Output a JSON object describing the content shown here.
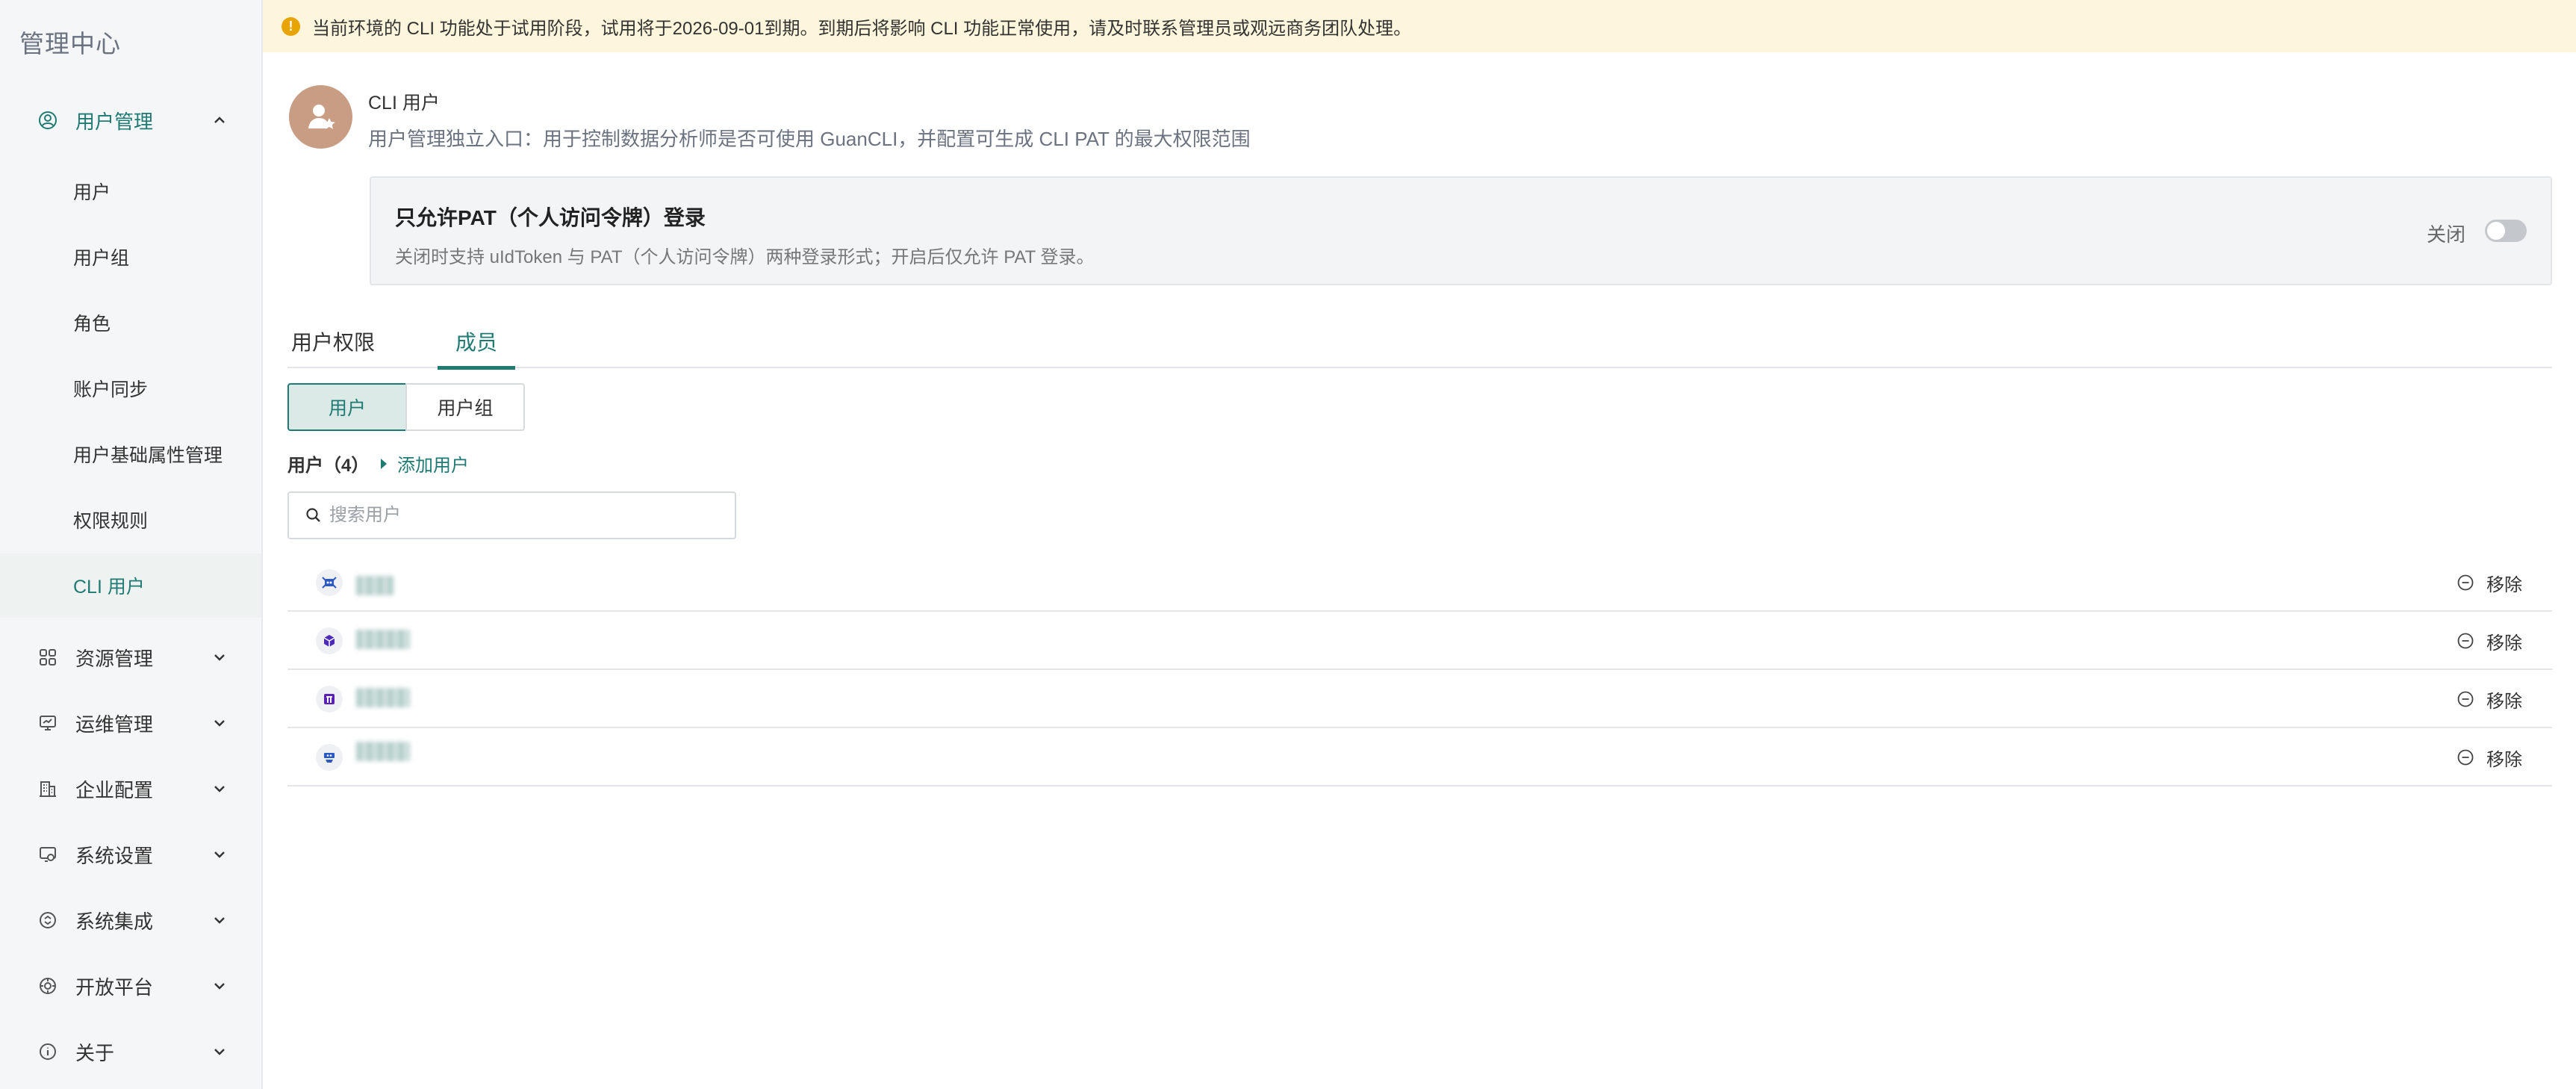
{
  "sidebar": {
    "brand": "管理中心",
    "user_management": {
      "label": "用户管理",
      "icon": "user-circle-icon",
      "items": [
        {
          "label": "用户"
        },
        {
          "label": "用户组"
        },
        {
          "label": "角色"
        },
        {
          "label": "账户同步"
        },
        {
          "label": "用户基础属性管理"
        },
        {
          "label": "权限规则"
        },
        {
          "label": "CLI 用户",
          "active": true
        }
      ]
    },
    "sections": [
      {
        "label": "资源管理",
        "icon": "grid-icon"
      },
      {
        "label": "运维管理",
        "icon": "monitor-icon"
      },
      {
        "label": "企业配置",
        "icon": "building-icon"
      },
      {
        "label": "系统设置",
        "icon": "settings-icon"
      },
      {
        "label": "系统集成",
        "icon": "integration-icon"
      },
      {
        "label": "开放平台",
        "icon": "platform-icon"
      },
      {
        "label": "关于",
        "icon": "info-icon"
      }
    ]
  },
  "notice": {
    "text": "当前环境的 CLI 功能处于试用阶段，试用将于2026-09-01到期。到期后将影响 CLI 功能正常使用，请及时联系管理员或观远商务团队处理。",
    "color": "#fdf6dc"
  },
  "header": {
    "title": "CLI 用户",
    "description": "用户管理独立入口：用于控制数据分析师是否可使用 GuanCLI，并配置可生成 CLI PAT 的最大权限范围"
  },
  "pat_setting": {
    "title": "只允许PAT（个人访问令牌）登录",
    "description": "关闭时支持 uIdToken 与 PAT（个人访问令牌）两种登录形式；开启后仅允许 PAT 登录。",
    "status_label": "关闭",
    "enabled": false
  },
  "tabs": [
    {
      "label": "用户权限",
      "active": false
    },
    {
      "label": "成员",
      "active": true
    }
  ],
  "segment": {
    "options": [
      "用户",
      "用户组"
    ],
    "selected": "用户"
  },
  "members": {
    "count_label": "用户（4）",
    "add_label": "添加用户",
    "search_placeholder": "搜索用户",
    "remove_label": "移除",
    "rows": [
      {
        "avatar_icon": "robot-avatar-icon"
      },
      {
        "avatar_icon": "cube-avatar-icon"
      },
      {
        "avatar_icon": "gate-avatar-icon"
      },
      {
        "avatar_icon": "bot-avatar-icon"
      }
    ]
  },
  "colors": {
    "accent": "#1f7a74",
    "sidebar_bg": "#f5f6f7",
    "warning": "#e8a400"
  }
}
